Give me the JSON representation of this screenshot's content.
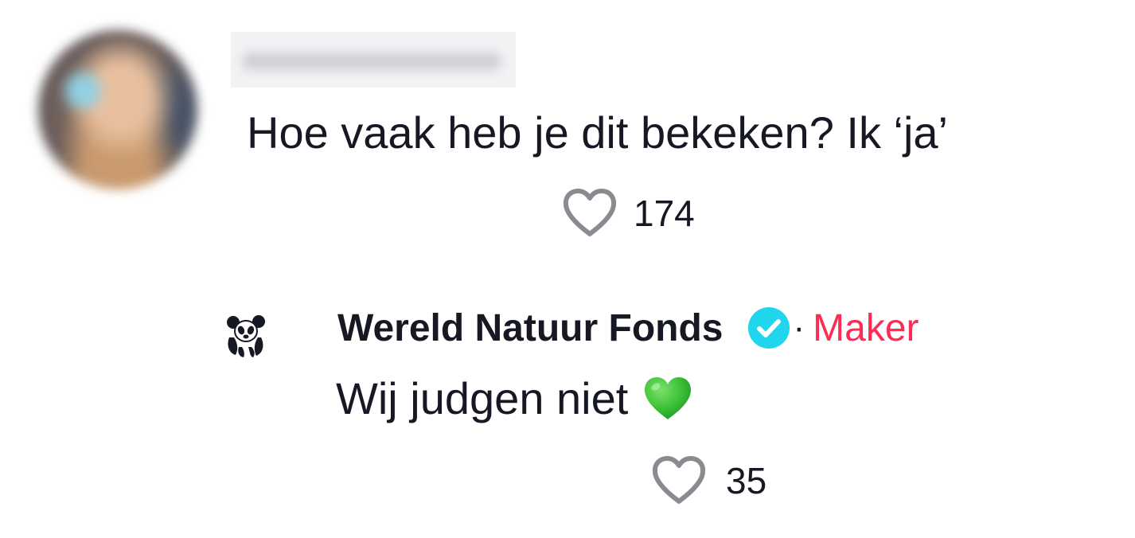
{
  "comment": {
    "text": "Hoe vaak heb je dit bekeken? Ik ‘ja’",
    "likes": "174",
    "like_icon": "heart-outline-icon"
  },
  "reply": {
    "author": "Wereld Natuur Fonds",
    "verified_icon": "verified-badge-icon",
    "separator": "·",
    "badge": "Maker",
    "text": "Wij judgen niet",
    "emoji": "green-heart-emoji",
    "likes": "35",
    "like_icon": "heart-outline-icon"
  },
  "colors": {
    "text": "#161823",
    "maker": "#fe2c55",
    "verified": "#20d5ec",
    "like_icon": "#8a8b91",
    "green_heart": "#3fc43a"
  }
}
